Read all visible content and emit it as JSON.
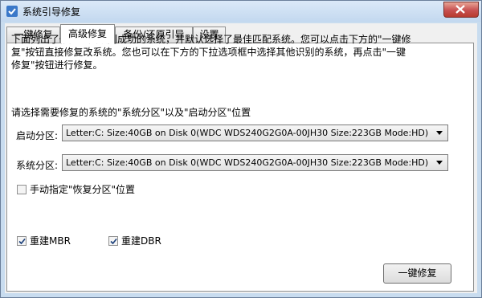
{
  "window": {
    "title": "系统引导修复"
  },
  "tabs": [
    {
      "label": "一键修复"
    },
    {
      "label": "高级修复"
    },
    {
      "label": "备份/还原引导"
    },
    {
      "label": "设置"
    }
  ],
  "panel": {
    "description_line1": "下面列出了修复工具识别成功的系统，并默认选择了最佳匹配系统。您可以点击下方的\"一键修",
    "description_line2": "复\"按钮直接修复改系统。您也可以在下方的下拉选项框中选择其他识别的系统，再点击\"一键",
    "description_line3": "修复\"按钮进行修复。",
    "prompt": "请选择需要修复的系统的\"系统分区\"以及\"启动分区\"位置",
    "boot_partition": {
      "label": "启动分区:",
      "value": "Letter:C: Size:40GB on Disk 0(WDC WDS240G2G0A-00JH30 Size:223GB Mode:HD)"
    },
    "system_partition": {
      "label": "系统分区:",
      "value": "Letter:C: Size:40GB on Disk 0(WDC WDS240G2G0A-00JH30 Size:223GB Mode:HD)"
    },
    "manual_recovery": {
      "label": "手动指定\"恢复分区\"位置",
      "checked": false
    },
    "rebuild_mbr": {
      "label": "重建MBR",
      "checked": true
    },
    "rebuild_dbr": {
      "label": "重建DBR",
      "checked": true
    },
    "repair_button": "一键修复"
  }
}
